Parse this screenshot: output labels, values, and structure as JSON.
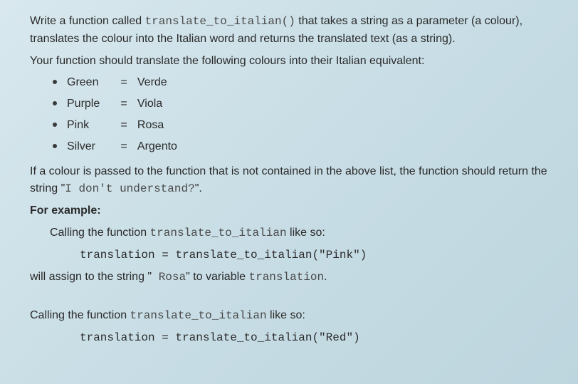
{
  "intro": {
    "line1_pre": "Write a function called ",
    "fn_sig": "translate_to_italian()",
    "line1_post": " that takes a string as a parameter (a colour), translates the colour into the Italian word and returns the translated text (as a string).",
    "line2": "Your function should translate the following colours into their Italian equivalent:"
  },
  "colours": [
    {
      "en": "Green",
      "eq": "=",
      "it": "Verde"
    },
    {
      "en": "Purple",
      "eq": "=",
      "it": "Viola"
    },
    {
      "en": "Pink",
      "eq": "=",
      "it": "Rosa"
    },
    {
      "en": "Silver",
      "eq": "=",
      "it": "Argento"
    }
  ],
  "fallback": {
    "pre": "If a colour is passed to the function that is not contained in the above list, the function should return the string \"",
    "code": "I don't understand?",
    "post": "\"."
  },
  "example_heading": "For example:",
  "ex1": {
    "call_pre": "Calling the function ",
    "fn": "translate_to_italian",
    "call_post": " like so:",
    "code": "translation = translate_to_italian(\"Pink\")",
    "result_pre": "will assign to the string \"",
    "result_code": " Rosa",
    "result_mid": "\" to variable ",
    "result_var": "translation",
    "result_post": "."
  },
  "ex2": {
    "call_pre": "Calling the function ",
    "fn": "translate_to_italian",
    "call_post": " like so:",
    "code": "translation = translate_to_italian(\"Red\")"
  }
}
